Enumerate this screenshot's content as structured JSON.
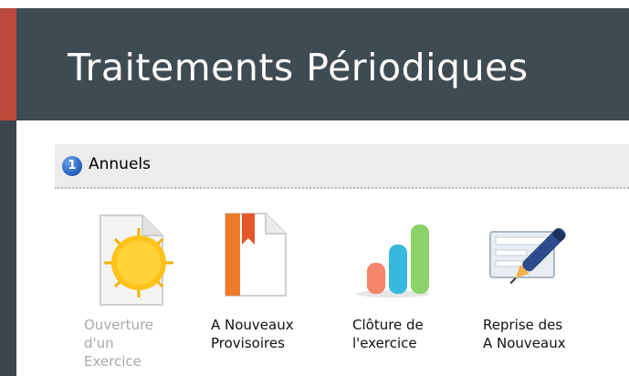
{
  "header": {
    "title": "Traitements Périodiques"
  },
  "section": {
    "number": "1",
    "title": "Annuels"
  },
  "tiles": [
    {
      "label": "Ouverture\nd'un\nExercice",
      "icon": "sun-document-icon",
      "enabled": false
    },
    {
      "label": "A Nouveaux\nProvisoires",
      "icon": "bookmark-document-icon",
      "enabled": true
    },
    {
      "label": "Clôture de\nl'exercice",
      "icon": "bar-chart-icon",
      "enabled": true
    },
    {
      "label": "Reprise des\nA Nouveaux",
      "icon": "pen-form-icon",
      "enabled": true
    }
  ],
  "colors": {
    "accent": "#b94a3c",
    "header_bg": "#3f4b53",
    "section_bg": "#ececec",
    "section_number_bg": "#2a67c4"
  }
}
